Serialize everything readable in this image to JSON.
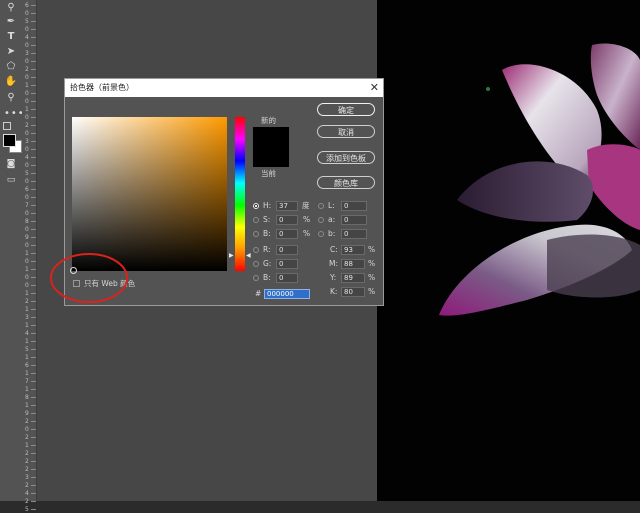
{
  "toolbar": {
    "tools": [
      "zoom-tool-icon",
      "pen-tool-icon",
      "type-tool-icon",
      "path-select-icon",
      "shape-tool-icon",
      "hand-tool-icon",
      "zoom-icon",
      "more-tools-icon"
    ]
  },
  "ruler": {
    "labels": [
      "6",
      "0",
      "5",
      "0",
      "4",
      "0",
      "3",
      "0",
      "2",
      "0",
      "1",
      "0",
      "0",
      "1",
      "0",
      "2",
      "0",
      "3",
      "0",
      "4",
      "0",
      "5",
      "0",
      "6",
      "0",
      "7",
      "0",
      "8",
      "0",
      "9",
      "0",
      "1",
      "0",
      "1",
      "0",
      "0",
      "1",
      "2",
      "1",
      "3",
      "1",
      "4",
      "1",
      "5",
      "1",
      "6",
      "1",
      "7",
      "1",
      "8",
      "1",
      "9",
      "2",
      "0",
      "2",
      "1",
      "2",
      "2",
      "2",
      "3",
      "2",
      "4",
      "2",
      "5"
    ]
  },
  "dialog": {
    "title": "拾色器（前景色）",
    "close": "✕",
    "buttons": {
      "ok": "确定",
      "cancel": "取消",
      "add_swatch": "添加到色板",
      "libraries": "颜色库"
    },
    "new_label": "新的",
    "current_label": "当前",
    "new_color": "#000000",
    "current_color": "#000000",
    "hue_color": "#ff9900",
    "web_only_label": "只有 Web 颜色",
    "hsb": [
      {
        "key": "H:",
        "value": "37",
        "unit": "度",
        "selected": true
      },
      {
        "key": "S:",
        "value": "0",
        "unit": "%",
        "selected": false
      },
      {
        "key": "B:",
        "value": "0",
        "unit": "%",
        "selected": false
      }
    ],
    "rgb": [
      {
        "key": "R:",
        "value": "0"
      },
      {
        "key": "G:",
        "value": "0"
      },
      {
        "key": "B:",
        "value": "0"
      }
    ],
    "lab": [
      {
        "key": "L:",
        "value": "0"
      },
      {
        "key": "a:",
        "value": "0"
      },
      {
        "key": "b:",
        "value": "0"
      }
    ],
    "cmyk": [
      {
        "key": "C:",
        "value": "93",
        "unit": "%"
      },
      {
        "key": "M:",
        "value": "88",
        "unit": "%"
      },
      {
        "key": "Y:",
        "value": "89",
        "unit": "%"
      },
      {
        "key": "K:",
        "value": "80",
        "unit": "%"
      }
    ],
    "hex_label": "#",
    "hex_value": "000000"
  },
  "annotation_color": "#d9231c"
}
